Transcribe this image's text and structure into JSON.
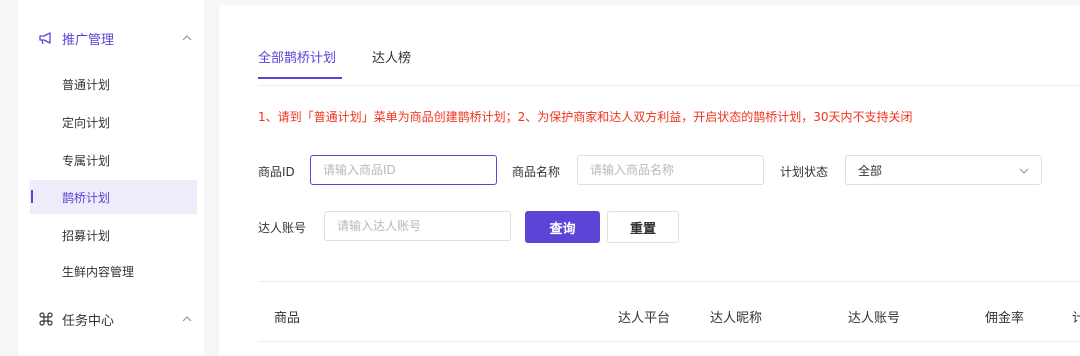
{
  "sidebar": {
    "group1": {
      "icon": "megaphone-icon",
      "label": "推广管理"
    },
    "items": [
      {
        "label": "普通计划"
      },
      {
        "label": "定向计划"
      },
      {
        "label": "专属计划"
      },
      {
        "label": "鹊桥计划"
      },
      {
        "label": "招募计划"
      },
      {
        "label": "生鲜内容管理"
      }
    ],
    "active_item": "鹊桥计划",
    "group2": {
      "icon": "command-icon",
      "label": "任务中心"
    }
  },
  "tabs": [
    {
      "label": "全部鹊桥计划",
      "active": true
    },
    {
      "label": "达人榜",
      "active": false
    }
  ],
  "notice": "1、请到「普通计划」菜单为商品创建鹊桥计划；2、为保护商家和达人双方利益，开启状态的鹊桥计划，30天内不支持关闭",
  "filters": {
    "product_id": {
      "label": "商品ID",
      "placeholder": "请输入商品ID",
      "value": ""
    },
    "product_name": {
      "label": "商品名称",
      "placeholder": "请输入商品名称",
      "value": ""
    },
    "plan_status": {
      "label": "计划状态",
      "value": "全部"
    },
    "influencer_account": {
      "label": "达人账号",
      "placeholder": "请输入达人账号",
      "value": ""
    }
  },
  "buttons": {
    "search": "查询",
    "reset": "重置"
  },
  "table": {
    "columns": [
      "商品",
      "达人平台",
      "达人昵称",
      "达人账号",
      "佣金率",
      "计"
    ]
  },
  "colors": {
    "accent": "#5a45d6",
    "notice": "#f0341c"
  }
}
